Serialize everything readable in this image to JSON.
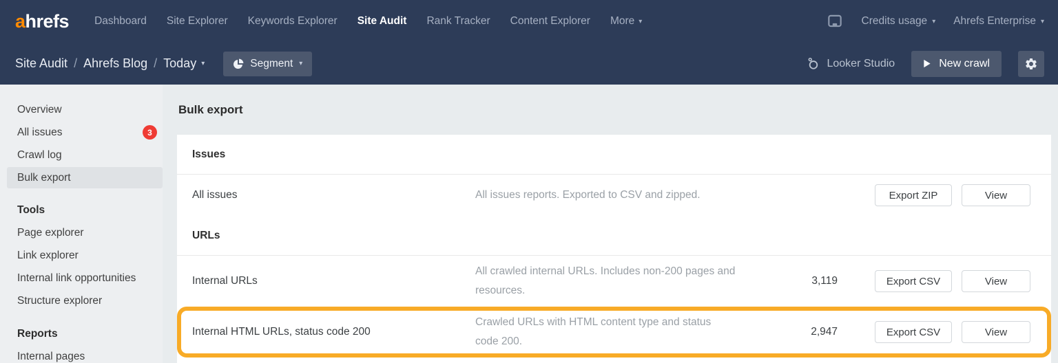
{
  "brand": {
    "logo_orange": "a",
    "logo_white": "hrefs",
    "accent_orange": "#ff8a00"
  },
  "colors": {
    "navbar_navy": "#2d3c58",
    "highlight_orange": "#f8ab27",
    "badge_red": "#ef3b34"
  },
  "topnav": {
    "items": [
      "Dashboard",
      "Site Explorer",
      "Keywords Explorer",
      "Site Audit",
      "Rank Tracker",
      "Content Explorer",
      "More"
    ],
    "active_item": "Site Audit",
    "credits_usage": "Credits usage",
    "enterprise": "Ahrefs Enterprise",
    "icons": [
      "laptop-icon"
    ]
  },
  "subnav": {
    "breadcrumb": [
      "Site Audit",
      "Ahrefs Blog",
      "Today"
    ],
    "segment": "Segment",
    "looker_studio": "Looker Studio",
    "new_crawl": "New crawl",
    "icons": [
      "pie-chart-icon",
      "looker-studio-icon",
      "play-icon",
      "gear-icon"
    ]
  },
  "sidebar": {
    "items": [
      {
        "label": "Overview"
      },
      {
        "label": "All issues",
        "badge": "3"
      },
      {
        "label": "Crawl log"
      },
      {
        "label": "Bulk export",
        "selected": true
      },
      {
        "label": "Tools",
        "header": true
      },
      {
        "label": "Page explorer"
      },
      {
        "label": "Link explorer"
      },
      {
        "label": "Internal link opportunities"
      },
      {
        "label": "Structure explorer"
      },
      {
        "label": "Reports",
        "header": true
      },
      {
        "label": "Internal pages"
      }
    ]
  },
  "main": {
    "title": "Bulk export",
    "sections": [
      {
        "header": "Issues",
        "rows": [
          {
            "label": "All issues",
            "description": "All issues reports. Exported to CSV and zipped.",
            "count": "",
            "export_label": "Export ZIP",
            "view_label": "View"
          }
        ]
      },
      {
        "header": "URLs",
        "rows": [
          {
            "label": "Internal URLs",
            "description": "All crawled internal URLs. Includes non-200 pages and resources.",
            "count": "3,119",
            "export_label": "Export CSV",
            "view_label": "View"
          },
          {
            "label": "Internal HTML URLs, status code 200",
            "description": "Crawled URLs with HTML content type and status code 200.",
            "count": "2,947",
            "export_label": "Export CSV",
            "view_label": "View",
            "highlighted": true
          }
        ]
      }
    ]
  }
}
